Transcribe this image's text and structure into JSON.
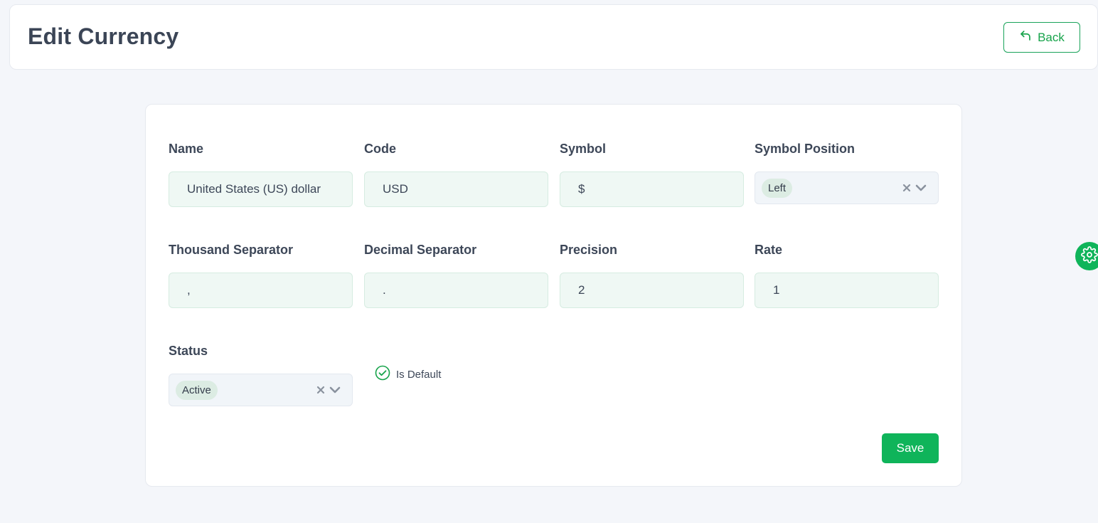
{
  "header": {
    "title": "Edit Currency",
    "back_label": "Back"
  },
  "form": {
    "name": {
      "label": "Name",
      "value": "United States (US) dollar"
    },
    "code": {
      "label": "Code",
      "value": "USD"
    },
    "symbol": {
      "label": "Symbol",
      "value": "$"
    },
    "symbol_position": {
      "label": "Symbol Position",
      "value": "Left"
    },
    "thousand_separator": {
      "label": "Thousand Separator",
      "value": ","
    },
    "decimal_separator": {
      "label": "Decimal Separator",
      "value": "."
    },
    "precision": {
      "label": "Precision",
      "value": "2"
    },
    "rate": {
      "label": "Rate",
      "value": "1"
    },
    "status": {
      "label": "Status",
      "value": "Active"
    },
    "is_default": {
      "label": "Is Default",
      "checked": true
    },
    "save_label": "Save"
  },
  "icons": {
    "back": "undo-arrow-icon",
    "clear": "close-icon",
    "dropdown": "chevron-down-icon",
    "check": "check-circle-icon",
    "settings": "gear-icon"
  },
  "colors": {
    "accent": "#0fb45a",
    "input_bg": "#eff8f4",
    "page_bg": "#f4f6fa"
  }
}
